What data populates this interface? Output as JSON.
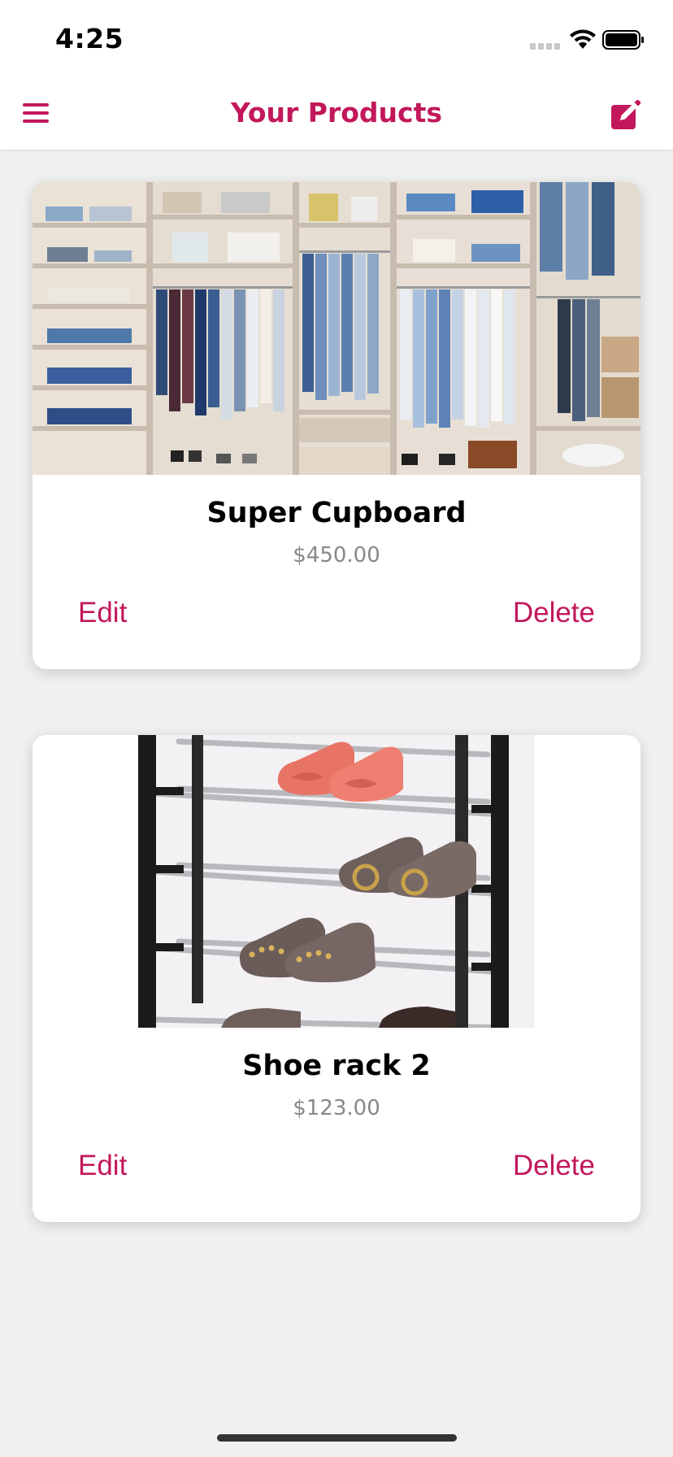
{
  "status_bar": {
    "time": "4:25"
  },
  "nav": {
    "title": "Your Products",
    "menu_icon": "hamburger-menu-icon",
    "add_icon": "edit-square-icon"
  },
  "products": [
    {
      "title": "Super Cupboard",
      "price": "$450.00",
      "edit_label": "Edit",
      "delete_label": "Delete",
      "image_subject": "wardrobe closet with hanging clothes"
    },
    {
      "title": "Shoe rack 2",
      "price": "$123.00",
      "edit_label": "Edit",
      "delete_label": "Delete",
      "image_subject": "black shoe rack with heels"
    }
  ],
  "colors": {
    "accent": "#c2185b",
    "background": "#f0f0f0",
    "price": "#888888"
  }
}
